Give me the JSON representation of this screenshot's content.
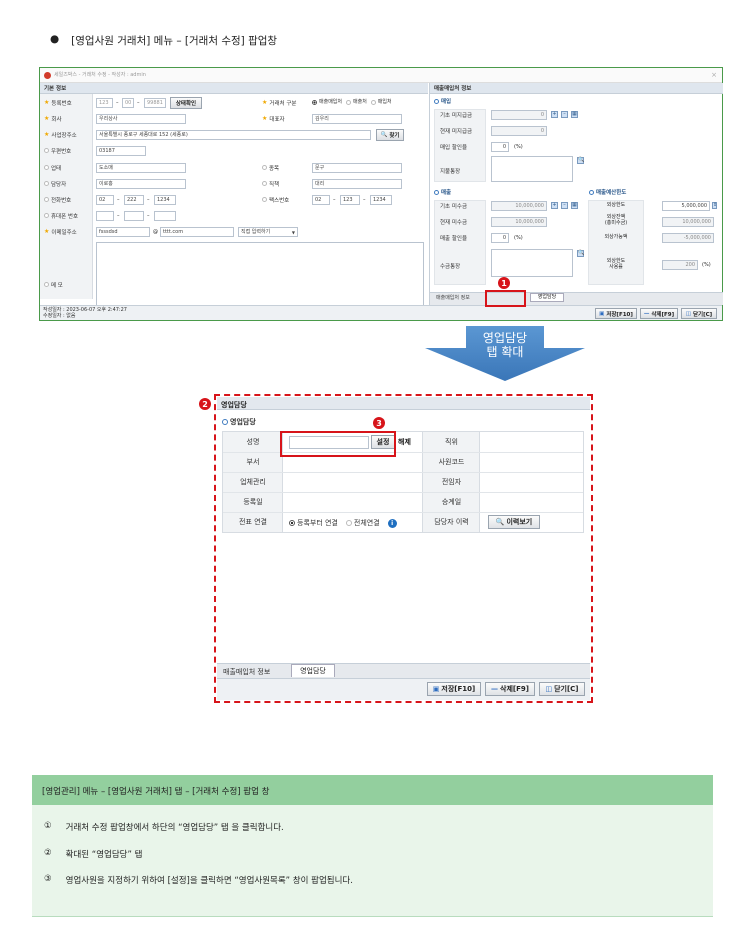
{
  "heading": {
    "bullet": "●",
    "text": "[영업사원 거래처] 메뉴 – [거래처 수정] 팝업창"
  },
  "window": {
    "title": "세일즈박스 - 거래처 수정 - 작성자 : admin",
    "basic_section": "기본 정보",
    "labels": {
      "reg_no": "등록번호",
      "company": "회사",
      "address": "사업장주소",
      "zip": "우편번호",
      "biz_type": "업태",
      "manager": "담당자",
      "phone": "전화번호",
      "mobile": "휴대폰 번호",
      "email": "이메일주소",
      "memo": "메 모",
      "trade_kind": "거래처 구분",
      "ceo": "대표자",
      "item": "종목",
      "position": "직책",
      "fax": "팩스번호"
    },
    "values": {
      "reg1": "123",
      "reg2": "00",
      "reg3": "99881",
      "company": "우리상사",
      "address": "서울특별시 종로구 세종대로 152 (세종로)",
      "zip": "03187",
      "biz_type": "도소매",
      "manager": "이로홍",
      "ph1": "02",
      "ph2": "222",
      "ph3": "1234",
      "email_id": "fsssdsd",
      "at": "@",
      "email_domain": "tttt.com",
      "domain_select": "직접 입력하기",
      "ceo": "김우리",
      "item": "문구",
      "position": "대리",
      "fax1": "02",
      "fax2": "123",
      "fax3": "1234",
      "dash": "–"
    },
    "buttons": {
      "check_status": "상태확인",
      "find": "찾기"
    },
    "radios": [
      "매출매입처",
      "매출처",
      "매입처"
    ],
    "right_section": "매출매입처 정보",
    "purchase_title": "매입",
    "sales_title": "매출",
    "credit_title": "매출예산한도",
    "purchase_labels": [
      "기초 미지급금",
      "현재 미지급금",
      "매입 할인율",
      "지불통장"
    ],
    "purchase_values": [
      "0",
      "0",
      "0",
      ""
    ],
    "sales_labels": [
      "기초 미수금",
      "현재 미수금",
      "매출 할인율",
      "수금통장"
    ],
    "sales_values": [
      "10,000,000",
      "10,000,000",
      "0",
      ""
    ],
    "credit_labels": [
      "외상한도",
      "외상잔액\n(총미수금)",
      "외상가능액",
      "외상한도\n사용률"
    ],
    "credit_values": [
      "5,000,000",
      "10,000,000",
      "-5,000,000",
      "200"
    ],
    "percent": "(%)",
    "tabs": [
      "매출매입처 정보",
      "영업담당"
    ],
    "footer1": "작성일자 : 2023-06-07 오후 2:47:27",
    "footer2": "수정일자 : 없음",
    "save": "저장[F10]",
    "delete": "삭제[F9]",
    "close": "닫기[C]"
  },
  "arrow_text": "영업담당\n탭 확대",
  "zoom": {
    "header": "영업담당",
    "section_title": "영업담당",
    "rows": [
      {
        "l1": "성명",
        "l2": "직위"
      },
      {
        "l1": "부서",
        "l2": "사원코드"
      },
      {
        "l1": "업체관리",
        "l2": "전임자"
      },
      {
        "l1": "등록일",
        "l2": "승계일"
      },
      {
        "l1": "전표 연결",
        "l2": "담당자 이력"
      }
    ],
    "set_button": "설정",
    "clear_button": "해제",
    "link_options": [
      "등록부터 연결",
      "전체연결"
    ],
    "history_button": "이력보기",
    "tabs": [
      "매출매입처 정보",
      "영업담당"
    ],
    "save": "저장[F10]",
    "delete": "삭제[F9]",
    "close": "닫기[C]"
  },
  "markers": [
    "1",
    "2",
    "3"
  ],
  "note": {
    "title": "[영업관리] 메뉴 – [영업사원 거래처] 탭 – [거래처 수정] 팝업 창",
    "items": [
      {
        "num": "①",
        "text": "거래처 수정 팝업창에서 하단의 “영업담당” 탭 을 클릭합니다."
      },
      {
        "num": "②",
        "text": "확대된 “영업담당” 탭"
      },
      {
        "num": "③",
        "text": "영업사원을 지정하기 위하여 [설정]을 클릭하면 “영업사원목록” 창이 팝업됩니다."
      }
    ]
  },
  "colors": {
    "accent_red": "#d7141a",
    "arrow_blue": "#4a86c5",
    "note_header": "#93cf9e",
    "note_body": "#e9f5ea"
  }
}
